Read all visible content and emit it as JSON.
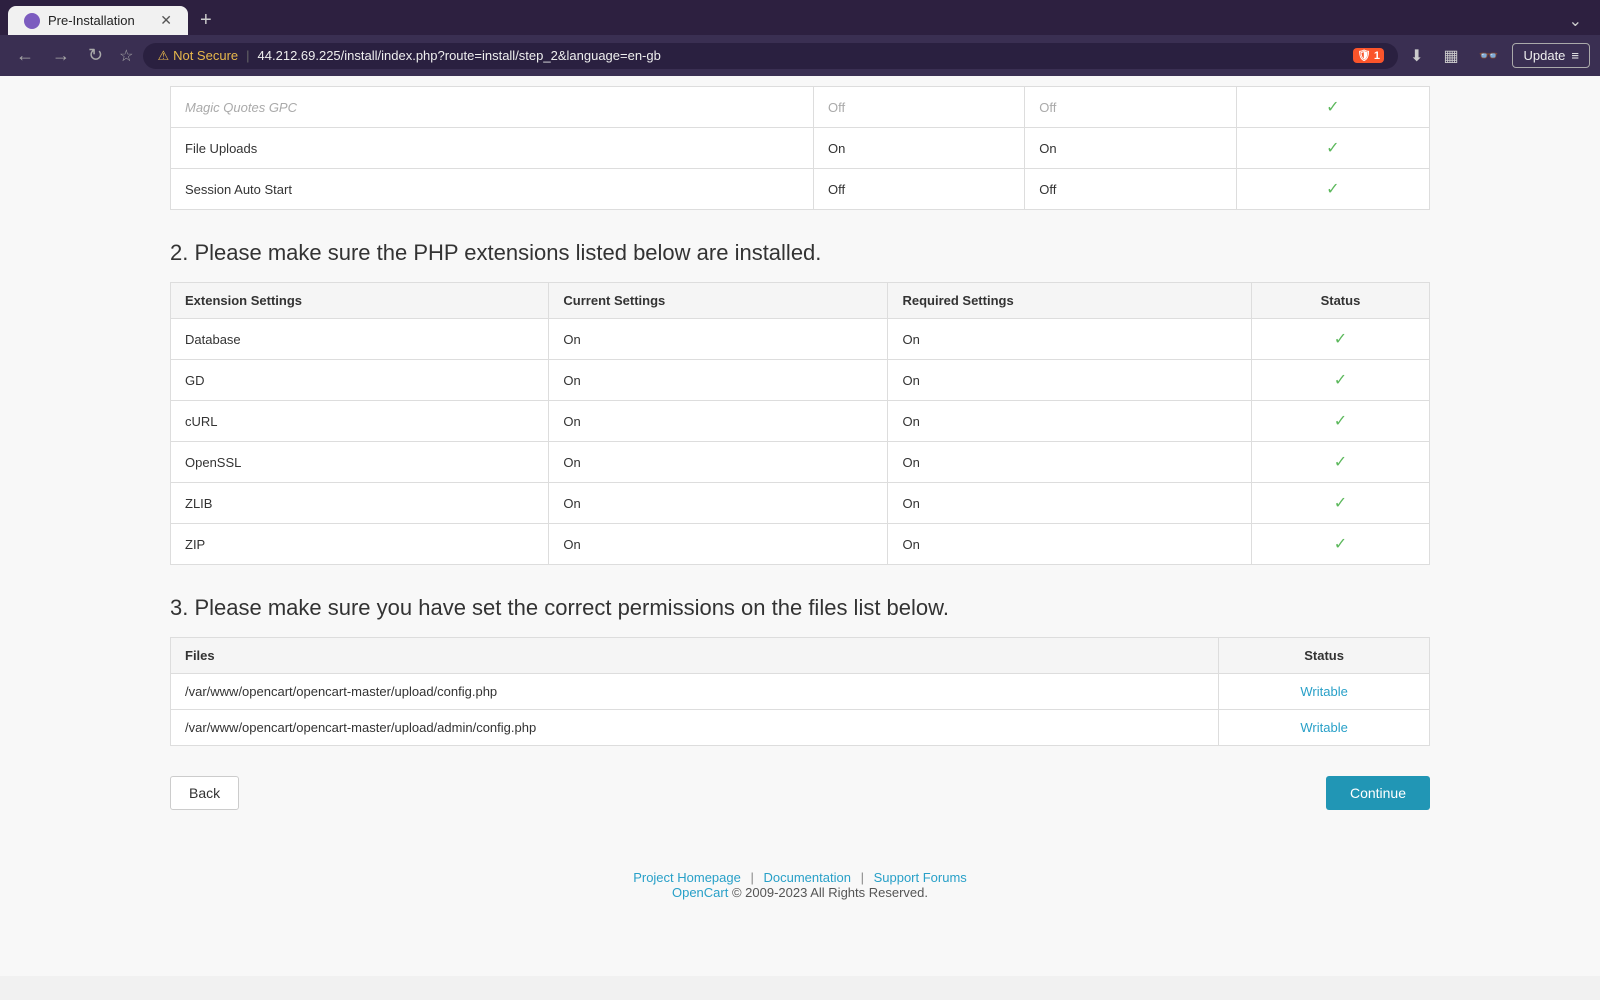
{
  "browser": {
    "tab_title": "Pre-Installation",
    "tab_new_label": "+",
    "tab_more_label": "⌄",
    "nav_back": "←",
    "nav_forward": "→",
    "nav_reload": "↻",
    "bookmark": "☆",
    "security_warning": "⚠",
    "not_secure_label": "Not Secure",
    "url_divider": "|",
    "url": "44.212.69.225/install/index.php?route=install/step_2&language=en-gb",
    "shield_count": "1",
    "download_icon": "⬇",
    "sidebar_icon": "▦",
    "leo_icon": "👓",
    "update_label": "Update",
    "update_menu": "≡"
  },
  "partial_table": {
    "rows": [
      {
        "setting": "Magic Quotes GPC",
        "current": "Off",
        "required": "Off",
        "status": "✓"
      },
      {
        "setting": "File Uploads",
        "current": "On",
        "required": "On",
        "status": "✓"
      },
      {
        "setting": "Session Auto Start",
        "current": "Off",
        "required": "Off",
        "status": "✓"
      }
    ]
  },
  "section2": {
    "heading": "2. Please make sure the PHP extensions listed below are installed.",
    "table": {
      "col_extension": "Extension Settings",
      "col_current": "Current Settings",
      "col_required": "Required Settings",
      "col_status": "Status",
      "rows": [
        {
          "extension": "Database",
          "current": "On",
          "required": "On",
          "status": "✓"
        },
        {
          "extension": "GD",
          "current": "On",
          "required": "On",
          "status": "✓"
        },
        {
          "extension": "cURL",
          "current": "On",
          "required": "On",
          "status": "✓"
        },
        {
          "extension": "OpenSSL",
          "current": "On",
          "required": "On",
          "status": "✓"
        },
        {
          "extension": "ZLIB",
          "current": "On",
          "required": "On",
          "status": "✓"
        },
        {
          "extension": "ZIP",
          "current": "On",
          "required": "On",
          "status": "✓"
        }
      ]
    }
  },
  "section3": {
    "heading": "3. Please make sure you have set the correct permissions on the files list below.",
    "table": {
      "col_files": "Files",
      "col_status": "Status",
      "rows": [
        {
          "file": "/var/www/opencart/opencart-master/upload/config.php",
          "status": "Writable"
        },
        {
          "file": "/var/www/opencart/opencart-master/upload/admin/config.php",
          "status": "Writable"
        }
      ]
    }
  },
  "buttons": {
    "back_label": "Back",
    "continue_label": "Continue"
  },
  "footer": {
    "link1": "Project Homepage",
    "div1": "|",
    "link2": "Documentation",
    "div2": "|",
    "link3": "Support Forums",
    "brand": "OpenCart",
    "copyright": "© 2009-2023 All Rights Reserved."
  }
}
